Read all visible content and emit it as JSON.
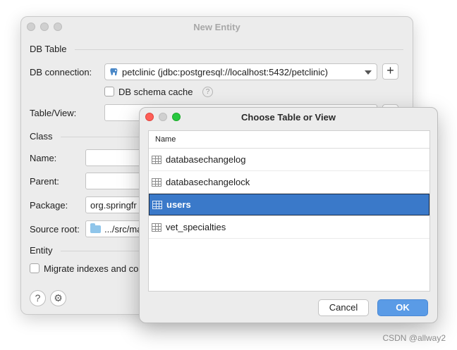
{
  "back_window": {
    "title": "New Entity",
    "db_table_section": "DB Table",
    "db_connection_label": "DB connection:",
    "db_connection_value": "petclinic (jdbc:postgresql://localhost:5432/petclinic)",
    "add_button": "+",
    "db_schema_cache_label": "DB schema cache",
    "help_glyph": "?",
    "table_view_label": "Table/View:",
    "class_section": "Class",
    "name_label": "Name:",
    "parent_label": "Parent:",
    "package_label": "Package:",
    "package_value": "org.springfr",
    "source_root_label": "Source root:",
    "source_root_value": ".../src/ma",
    "entity_section": "Entity",
    "migrate_label": "Migrate indexes and co",
    "bottom_help_glyph": "?",
    "bottom_settings_glyph": "⚙"
  },
  "dialog": {
    "title": "Choose Table or View",
    "column_header": "Name",
    "rows": [
      {
        "label": "databasechangelog",
        "selected": false
      },
      {
        "label": "databasechangelock",
        "selected": false
      },
      {
        "label": "users",
        "selected": true
      },
      {
        "label": "vet_specialties",
        "selected": false
      }
    ],
    "cancel_label": "Cancel",
    "ok_label": "OK"
  },
  "watermark": "CSDN @allway2",
  "colors": {
    "selection": "#3a79c9",
    "ok_button": "#5a9be6",
    "close_red": "#fe5f57",
    "zoom_green": "#28c840"
  },
  "icons": [
    "postgresql-elephant-icon",
    "table-icon",
    "folder-icon",
    "help-icon",
    "gear-icon"
  ]
}
